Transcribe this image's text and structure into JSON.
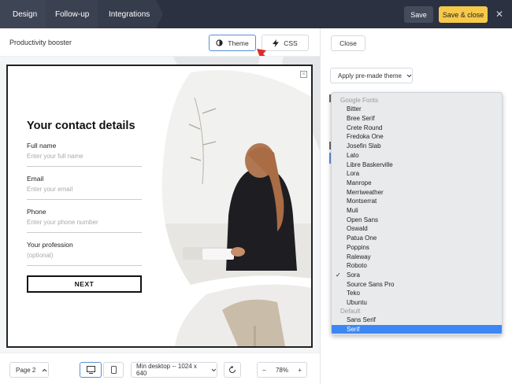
{
  "topbar": {
    "steps": [
      "Design",
      "Follow-up",
      "Integrations"
    ],
    "save_label": "Save",
    "save_close_label": "Save & close",
    "close_glyph": "✕"
  },
  "editor": {
    "campaign_title": "Productivity booster",
    "theme_label": "Theme",
    "css_label": "CSS"
  },
  "popup": {
    "close_glyph": "×",
    "title": "Your contact details",
    "fields": [
      {
        "label": "Full name",
        "placeholder": "Enter your full name"
      },
      {
        "label": "Email",
        "placeholder": "Enter your email"
      },
      {
        "label": "Phone",
        "placeholder": "Enter your phone number"
      },
      {
        "label": "Your profession",
        "placeholder": "(optional)"
      }
    ],
    "next_label": "NEXT"
  },
  "bottombar": {
    "page_label": "Page 2",
    "resolution_label": "Min desktop -- 1024 x 640",
    "zoom_value": "78%",
    "zoom_minus": "−",
    "zoom_plus": "+"
  },
  "panel": {
    "close_label": "Close",
    "premade_label": "Apply pre-made theme"
  },
  "font_dropdown": {
    "group_google": "Google Fonts",
    "google_fonts": [
      "Bitter",
      "Bree Serif",
      "Crete Round",
      "Fredoka One",
      "Josefin Slab",
      "Lato",
      "Libre Baskerville",
      "Lora",
      "Manrope",
      "Merriweather",
      "Montserrat",
      "Muli",
      "Open Sans",
      "Oswald",
      "Patua One",
      "Poppins",
      "Raleway",
      "Roboto",
      "Sora",
      "Source Sans Pro",
      "Teko",
      "Ubuntu"
    ],
    "group_default": "Default",
    "default_fonts": [
      "Sans Serif",
      "Serif"
    ],
    "checked_font": "Sora",
    "highlighted_font": "Serif",
    "check_glyph": "✓"
  },
  "colors": {
    "topbar_bg": "#2b3140",
    "accent_yellow": "#f6c94a",
    "accent_blue": "#3d87f5",
    "arrow_red": "#e02a2a"
  }
}
